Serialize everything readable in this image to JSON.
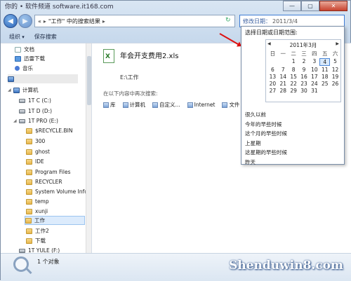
{
  "window": {
    "site_watermark": "你的 • 软件频道  software.it168.com",
    "caption_buttons": [
      "—",
      "▢",
      "✕"
    ]
  },
  "nav": {
    "back": "◀",
    "forward": "▶",
    "address_parts": [
      "«",
      "\"工作\" 中的搜索结果",
      "▸"
    ],
    "search_key": "修改日期：",
    "search_value": "2011/3/4"
  },
  "toolbar": {
    "organize": "组织",
    "save_search": "保存搜索"
  },
  "sidebar": {
    "items": [
      {
        "label": "文档",
        "icon": "doc"
      },
      {
        "label": "迅雷下载",
        "icon": "dl"
      },
      {
        "label": "音乐",
        "icon": "music"
      },
      {
        "label": "",
        "icon": "pc"
      },
      {
        "label": "计算机",
        "icon": "pc"
      },
      {
        "label": "1T C (C:)",
        "icon": "drive"
      },
      {
        "label": "1T D (D:)",
        "icon": "drive"
      },
      {
        "label": "1T PRO (E:)",
        "icon": "drive"
      },
      {
        "label": "$RECYCLE.BIN",
        "icon": "folder"
      },
      {
        "label": "300",
        "icon": "folder"
      },
      {
        "label": "ghost",
        "icon": "folder"
      },
      {
        "label": "IDE",
        "icon": "folder"
      },
      {
        "label": "Program Files",
        "icon": "folder"
      },
      {
        "label": "RECYCLER",
        "icon": "folder"
      },
      {
        "label": "System Volume Info",
        "icon": "folder"
      },
      {
        "label": "temp",
        "icon": "folder"
      },
      {
        "label": "xunji",
        "icon": "folder"
      },
      {
        "label": "工作",
        "icon": "folder"
      },
      {
        "label": "工作2",
        "icon": "folder"
      },
      {
        "label": "下载",
        "icon": "folder"
      },
      {
        "label": "1T YULE (F:)",
        "icon": "drive"
      }
    ]
  },
  "content": {
    "file_name": "年会开支费用2.xls",
    "file_path": "E:\\工作",
    "search_again_label": "在以下内容中再次搜索:",
    "search_again_locations": [
      "库",
      "计算机",
      "自定义...",
      "Internet",
      "文件"
    ]
  },
  "date_dropdown": {
    "title": "选择日期或日期范围:",
    "calendar": {
      "month_label": "2011年3月",
      "weekdays": [
        "日",
        "一",
        "二",
        "三",
        "四",
        "五",
        "六"
      ],
      "weeks": [
        [
          "",
          "",
          "1",
          "2",
          "3",
          "4",
          "5"
        ],
        [
          "6",
          "7",
          "8",
          "9",
          "10",
          "11",
          "12"
        ],
        [
          "13",
          "14",
          "15",
          "16",
          "17",
          "18",
          "19"
        ],
        [
          "20",
          "21",
          "22",
          "23",
          "24",
          "25",
          "26"
        ],
        [
          "27",
          "28",
          "29",
          "30",
          "31",
          "",
          ""
        ]
      ],
      "selected_day": "4"
    },
    "options": [
      "很久以前",
      "今年的早些时候",
      "这个月的早些时候",
      "上星期",
      "这星期的早些时候",
      "昨天"
    ]
  },
  "status": {
    "text": "1 个对象"
  },
  "brand": "Shenduwin8.com"
}
